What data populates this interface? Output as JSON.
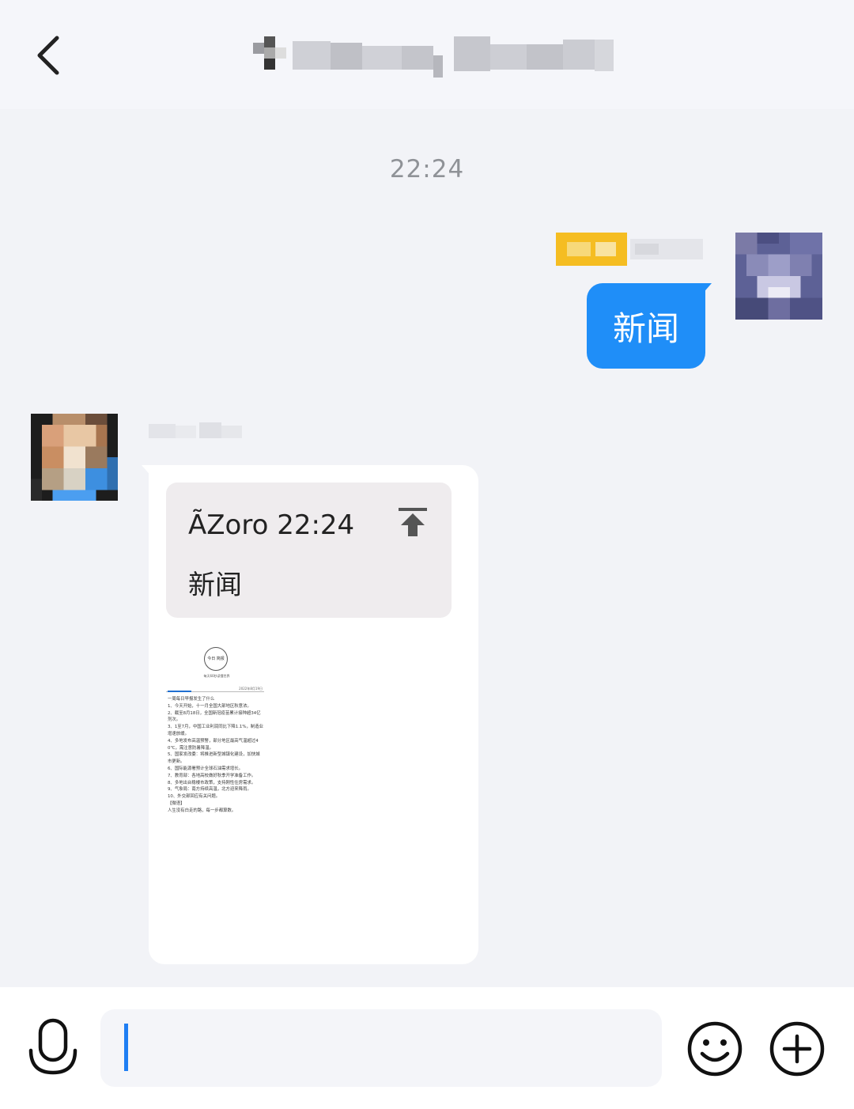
{
  "header": {
    "back_icon": "chevron-left-icon",
    "title_obscured": true
  },
  "chat": {
    "time_divider": "22:24",
    "outgoing": {
      "text": "新闻",
      "name_obscured": true,
      "avatar_obscured": true,
      "bubble_color": "#1f8ef8"
    },
    "incoming": {
      "name_obscured": true,
      "avatar_obscured": true,
      "quote": {
        "sender_time": "ÃZoro 22:24",
        "text": "新闻",
        "icon": "pin-top-icon"
      },
      "document_thumbnail": {
        "logo_text": "今日\n简报",
        "logo_caption": "每天60秒读懂世界",
        "date": "2022年8月19日",
        "body": "一周每日早报发生了什么\n1、今天开始，十一月全国大部地区秋意浓。\n2、截至8月18日，全国新冠疫苗累计接种超34亿剂次。\n3、1至7月，中国工业利润同比下降1.1%，制造业增速放缓。\n4、多地发布高温预警，部分地区最高气温超过40℃，需注意防暑降温。\n5、国家发改委：将推进新型城镇化建设，加快城市更新。\n6、国际能源署预计全球石油需求增长。\n7、教育部：各地高校做好秋季开学准备工作。\n8、多地出台稳楼市政策，支持刚性住房需求。\n9、气象局：南方持续高温，北方迎来降雨。\n10、外交部回应有关问题。\n【微语】\n人生没有白走的路，每一步都算数。"
      }
    }
  },
  "input_bar": {
    "voice_icon": "microphone-icon",
    "emoji_icon": "smiley-icon",
    "plus_icon": "plus-circle-icon",
    "input_value": "",
    "accent_color": "#1f7ef3"
  }
}
